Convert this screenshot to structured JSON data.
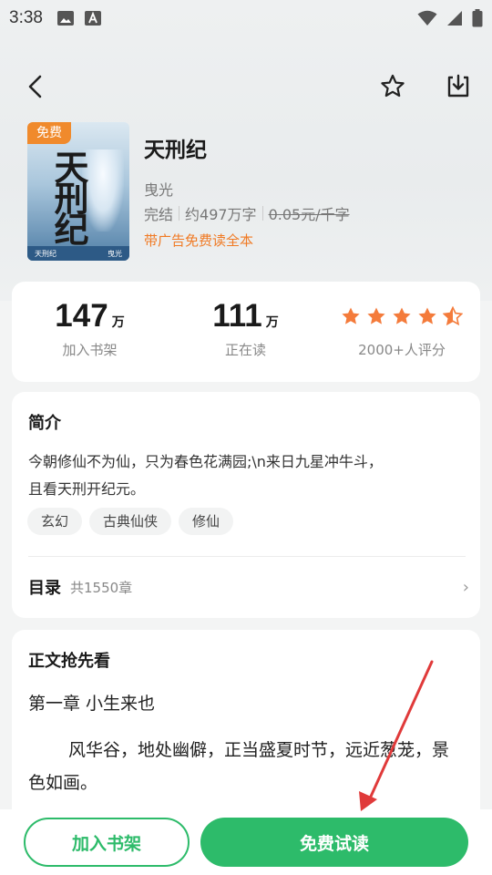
{
  "status_bar": {
    "time": "3:38"
  },
  "book": {
    "cover_badge": "免费",
    "cover_title": "天刑纪",
    "cover_footer_left": "天刑纪",
    "cover_footer_right": "曳光",
    "title": "天刑纪",
    "author": "曳光",
    "status": "完结",
    "word_count": "约497万字",
    "price": "0.05元/千字",
    "promo": "带广告免费读全本"
  },
  "stats": {
    "shelf_num": "147",
    "shelf_unit": "万",
    "shelf_label": "加入书架",
    "reading_num": "111",
    "reading_unit": "万",
    "reading_label": "正在读",
    "rating_stars": 4.5,
    "rating_label": "2000+人评分"
  },
  "intro": {
    "title": "简介",
    "text_line1": "今朝修仙不为仙，只为春色花满园;\\n来日九星冲牛斗，",
    "text_line2": "且看天刑开纪元。",
    "tags": [
      "玄幻",
      "古典仙侠",
      "修仙"
    ],
    "toc_title": "目录",
    "toc_count": "共1550章",
    "toc_arrow": "›"
  },
  "preview": {
    "title": "正文抢先看",
    "chapter_title": "第一章 小生来也",
    "chapter_text": "风华谷，地处幽僻，正当盛夏时节，远近葱茏，景色如画。"
  },
  "bottom_bar": {
    "shelf_button": "加入书架",
    "read_button": "免费试读"
  },
  "colors": {
    "accent_green": "#2dbb6a",
    "accent_orange": "#f07a24",
    "star_orange": "#f47b3b",
    "annotation_red": "#e03a3a"
  },
  "icons": {
    "back": "back-arrow-icon",
    "favorite": "star-outline-icon",
    "download": "download-icon"
  }
}
